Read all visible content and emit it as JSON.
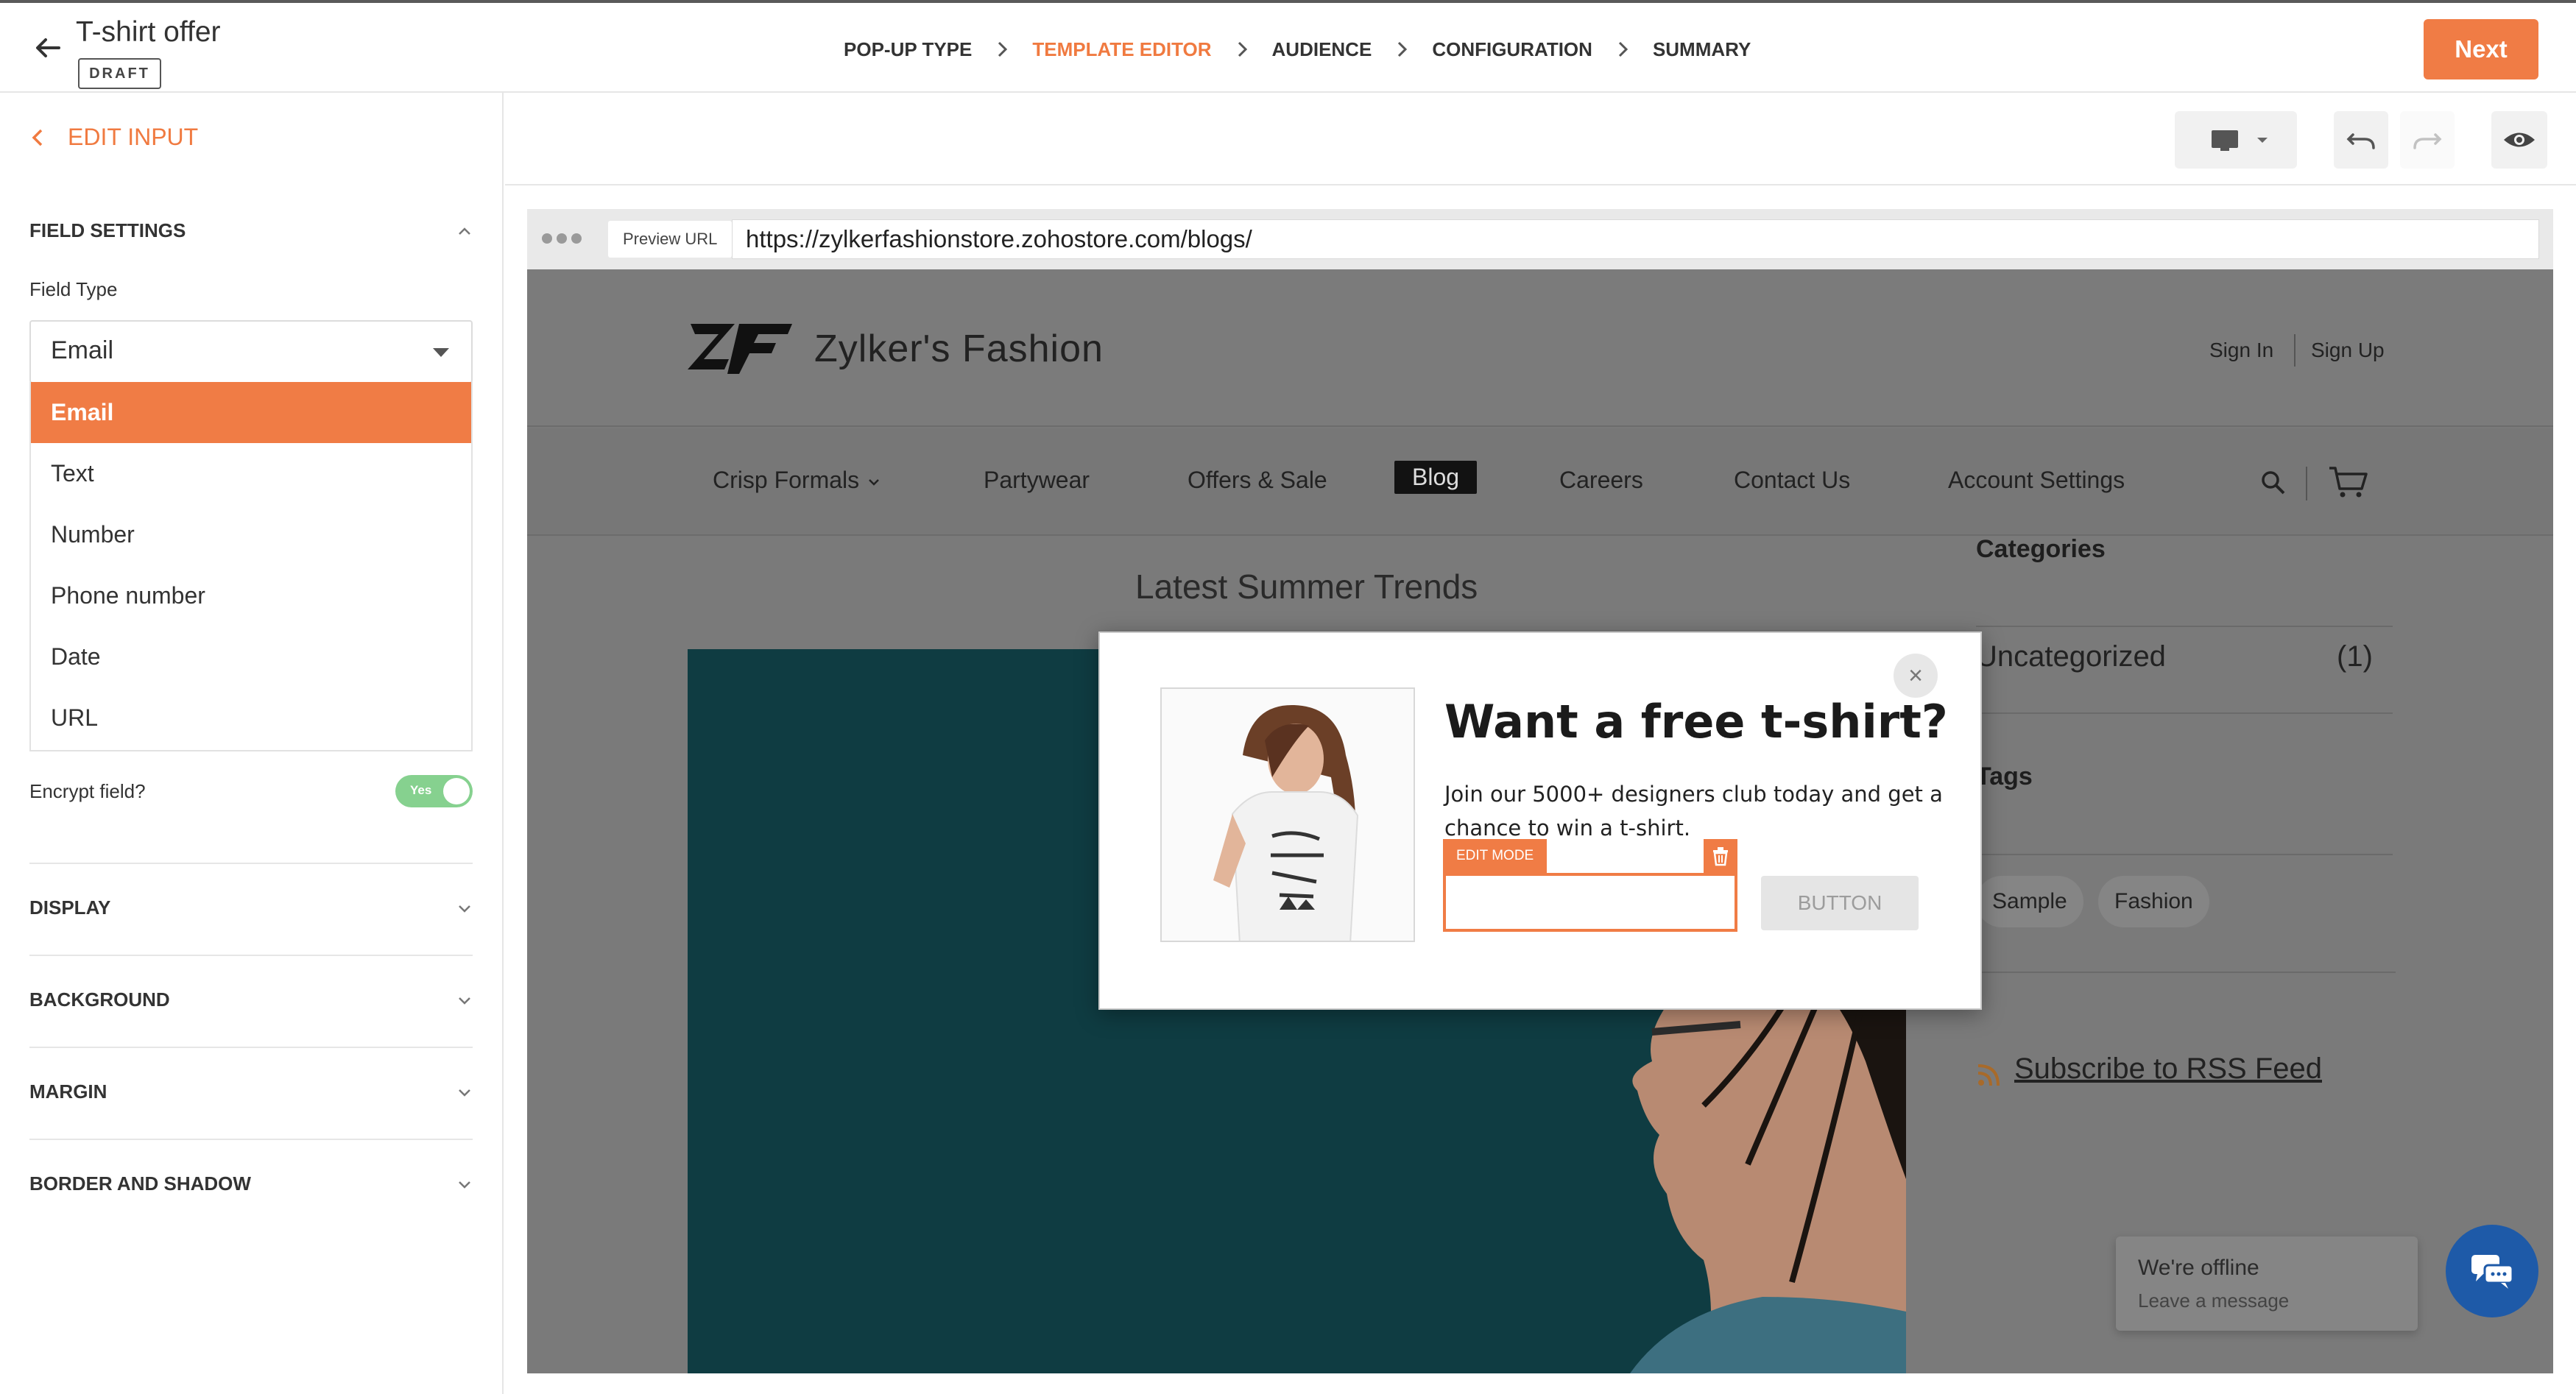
{
  "header": {
    "title": "T-shirt offer",
    "badge": "DRAFT",
    "steps": [
      {
        "label": "POP-UP TYPE"
      },
      {
        "label": "TEMPLATE EDITOR"
      },
      {
        "label": "AUDIENCE"
      },
      {
        "label": "CONFIGURATION"
      },
      {
        "label": "SUMMARY"
      }
    ],
    "active_step": "TEMPLATE EDITOR",
    "next_label": "Next"
  },
  "left_panel": {
    "back_label": "EDIT INPUT",
    "field_settings_title": "FIELD SETTINGS",
    "field_type_label": "Field Type",
    "field_type_value": "Email",
    "field_type_options": [
      "Email",
      "Text",
      "Number",
      "Phone number",
      "Date",
      "URL"
    ],
    "encrypt_label": "Encrypt field?",
    "encrypt_toggle": "Yes",
    "encrypt_on": true,
    "sections": [
      "DISPLAY",
      "BACKGROUND",
      "MARGIN",
      "BORDER AND SHADOW"
    ]
  },
  "toolbar": {
    "device_icon": "monitor-icon",
    "undo_icon": "undo-icon",
    "redo_icon": "redo-icon",
    "preview_icon": "eye-icon"
  },
  "preview": {
    "url_tag": "Preview URL",
    "url": "https://zylkerfashionstore.zohostore.com/blogs/",
    "site": {
      "brand": "Zylker's Fashion",
      "sign_in": "Sign In",
      "sign_up": "Sign Up",
      "nav": [
        "Crisp Formals",
        "Partywear",
        "Offers & Sale",
        "Blog",
        "Careers",
        "Contact Us",
        "Account Settings"
      ],
      "active_nav": "Blog",
      "post_title": "Latest Summer Trends",
      "sidebar": {
        "categories_title": "Categories",
        "category_name": "Uncategorized",
        "category_count": "(1)",
        "tags_title": "Tags",
        "tags": [
          "Sample",
          "Fashion"
        ],
        "rss_label": "Subscribe to RSS Feed"
      },
      "chat": {
        "offline_title": "We're offline",
        "offline_sub": "Leave a message"
      }
    },
    "popup": {
      "title": "Want a free t-shirt?",
      "text": "Join our 5000+ designers club today and get a chance to win a t-shirt.",
      "edit_mode_label": "EDIT MODE",
      "button_label": "BUTTON",
      "close_glyph": "×"
    }
  },
  "colors": {
    "accent": "#f07c45",
    "toggle_on": "#86d18f",
    "chat_button": "#1e5aa8",
    "hero_bg": "#0f3c42"
  }
}
